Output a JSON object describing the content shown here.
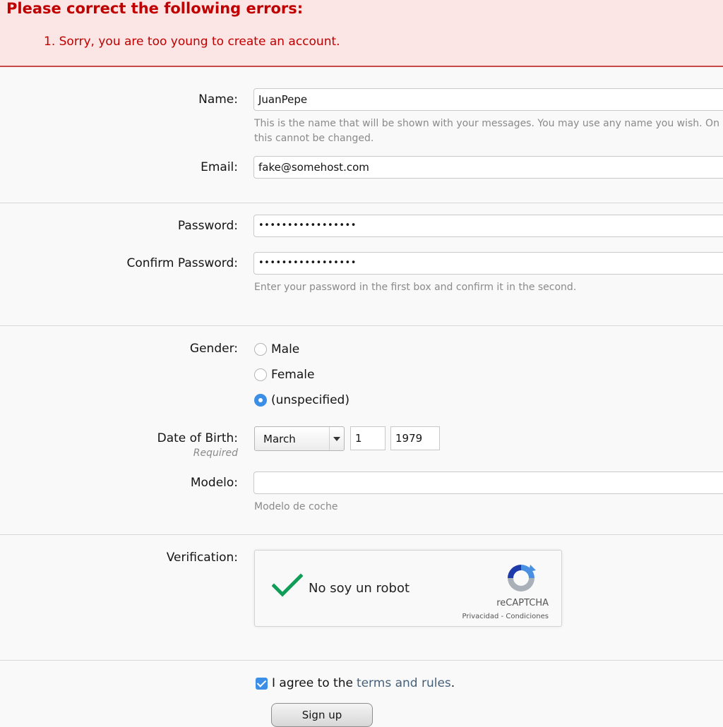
{
  "errors": {
    "title": "Please correct the following errors:",
    "items": [
      "1. Sorry, you are too young to create an account."
    ]
  },
  "name": {
    "label": "Name:",
    "value": "JuanPepe",
    "hint_line1": "This is the name that will be shown with your messages. You may use any name you wish. On",
    "hint_line2": "this cannot be changed."
  },
  "email": {
    "label": "Email:",
    "value": "fake@somehost.com"
  },
  "password": {
    "label": "Password:",
    "value": "•••••••••••••••••"
  },
  "confirm_password": {
    "label": "Confirm Password:",
    "value": "•••••••••••••••••",
    "hint": "Enter your password in the first box and confirm it in the second."
  },
  "gender": {
    "label": "Gender:",
    "options": [
      "Male",
      "Female",
      "(unspecified)"
    ],
    "selected": "(unspecified)"
  },
  "dob": {
    "label": "Date of Birth:",
    "required": "Required",
    "month": "March",
    "day": "1",
    "year": "1979"
  },
  "modelo": {
    "label": "Modelo:",
    "value": "",
    "hint": "Modelo de coche"
  },
  "verification": {
    "label": "Verification:",
    "checkbox_text": "No soy un robot",
    "brand": "reCAPTCHA",
    "links": "Privacidad - Condiciones"
  },
  "agree": {
    "prefix": "I agree to the",
    "link": "terms and rules",
    "suffix": ".",
    "checked": true
  },
  "signup_label": "Sign up",
  "colors": {
    "error_text": "#c00000",
    "error_bg": "#fbe5e5",
    "accent": "#3b8fe6",
    "captcha_check": "#0f9d58"
  }
}
